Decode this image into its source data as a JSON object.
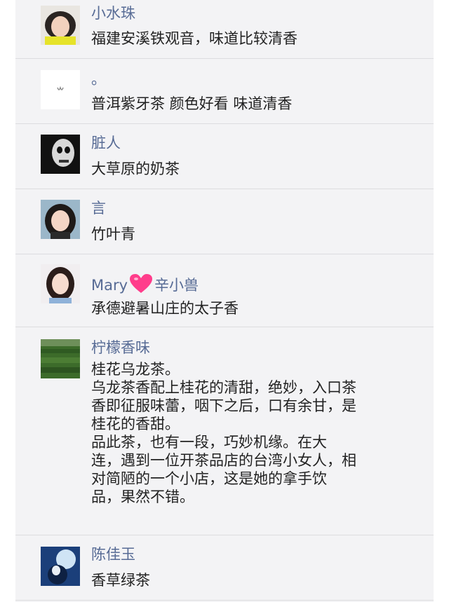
{
  "comments": [
    {
      "name": "小水珠",
      "text": "福建安溪铁观音，味道比较清香",
      "avatar_icon": "avatar-girl-yellow"
    },
    {
      "name": "。",
      "text": "普洱紫牙茶 颜色好看 味道清香",
      "avatar_icon": "avatar-white-small-logo"
    },
    {
      "name": "脏人",
      "text": "大草原的奶茶",
      "avatar_icon": "avatar-dark-skull"
    },
    {
      "name": "言",
      "text": "竹叶青",
      "avatar_icon": "avatar-girl-dark-hair"
    },
    {
      "name": "Mary",
      "name_suffix": "辛小兽",
      "name_emoji": "heart-emoji",
      "text": "承德避暑山庄的太子香",
      "avatar_icon": "avatar-girl-portrait"
    },
    {
      "name": "柠檬香味",
      "text": "桂花乌龙茶。\n乌龙茶香配上桂花的清甜，绝妙，入口茶\n香即征服味蕾，咽下之后，口有余甘，是\n桂花的香甜。\n品此茶，也有一段，巧妙机缘。在大\n连，遇到一位开茶品店的台湾小女人，相\n对简陋的一个小店，这是她的拿手饮\n品，果然不错。",
      "avatar_icon": "avatar-green-field"
    },
    {
      "name": "陈佳玉",
      "text": "香草绿茶",
      "avatar_icon": "avatar-blue-anime"
    }
  ],
  "colors": {
    "name": "#576b95",
    "text": "#222222",
    "panel": "#f3f3f5",
    "divider": "#dcdcdf",
    "heart": "#ff3d8b"
  }
}
